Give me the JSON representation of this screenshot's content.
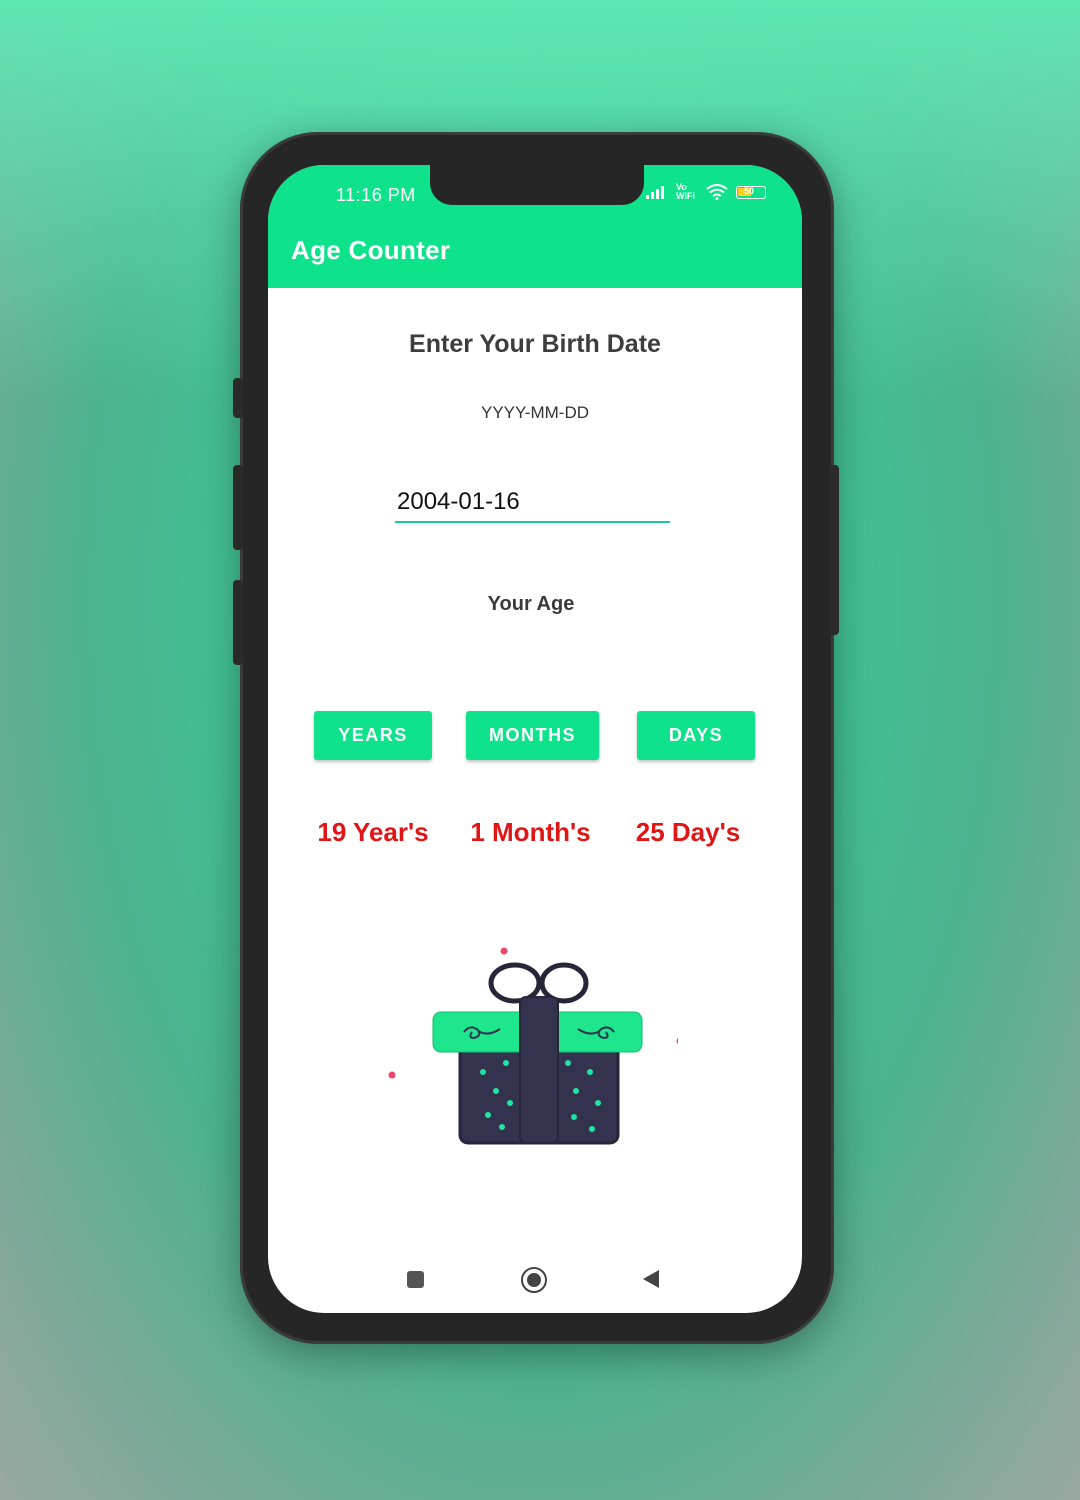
{
  "status_bar": {
    "time": "11:16 PM",
    "icons": [
      "signal-icon",
      "vowifi-icon",
      "wifi-icon",
      "battery-icon"
    ],
    "vowifi_text": "Vo WiFi",
    "battery_level": "50"
  },
  "app": {
    "title": "Age Counter",
    "accent_color": "#0ee38c"
  },
  "form": {
    "heading": "Enter Your Birth Date",
    "format_hint": "YYYY-MM-DD",
    "date_value": "2004-01-16"
  },
  "age": {
    "label": "Your Age",
    "buttons": {
      "years": "YEARS",
      "months": "MONTHS",
      "days": "DAYS"
    },
    "results": {
      "years": "19 Year's",
      "months": "1 Month's",
      "days": "25 Day's"
    },
    "result_color": "#e01515"
  },
  "illustration": "gift-box-icon",
  "nav": {
    "icons": [
      "recents-square-icon",
      "home-circle-icon",
      "back-triangle-icon"
    ]
  }
}
